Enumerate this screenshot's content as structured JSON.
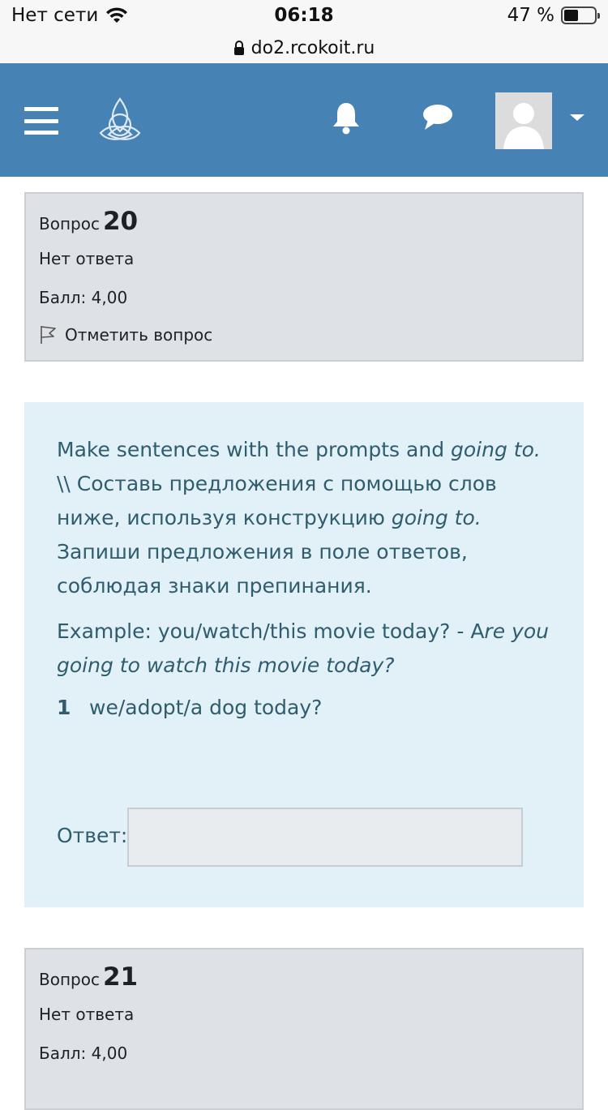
{
  "status_bar": {
    "carrier": "Нет сети",
    "time": "06:18",
    "battery": "47 %",
    "battery_level": 0.47
  },
  "url_bar": {
    "url": "do2.rcokoit.ru"
  },
  "header": {
    "colors": {
      "background": "#4682b4",
      "icon": "#ffffff"
    },
    "icons": [
      "menu-icon",
      "site-logo",
      "bell-icon",
      "chat-icon",
      "avatar",
      "caret-down-icon"
    ]
  },
  "question20": {
    "label": "Вопрос",
    "number": "20",
    "state": "Нет ответа",
    "grade": "Балл: 4,00",
    "flag": "Отметить вопрос"
  },
  "content": {
    "intro_part1": "Make sentences with the prompts and ",
    "intro_going": "going to.",
    "intro_part2": " \\\\ Составь предложения с помощью слов ниже, используя конструкцию ",
    "intro_going2": "going to.",
    "intro_part3": " Запиши предложения в поле ответов, соблюдая знаки препинания.",
    "example_prefix": "Example: you/watch/this movie today? - A",
    "example_italic": "re you going to watch this movie today?",
    "item_number": "1",
    "item_text": "we/adopt/a dog today?",
    "answer_label": "Ответ:",
    "answer_value": ""
  },
  "question21": {
    "label": "Вопрос",
    "number": "21",
    "state": "Нет ответа",
    "grade": "Балл: 4,00"
  }
}
